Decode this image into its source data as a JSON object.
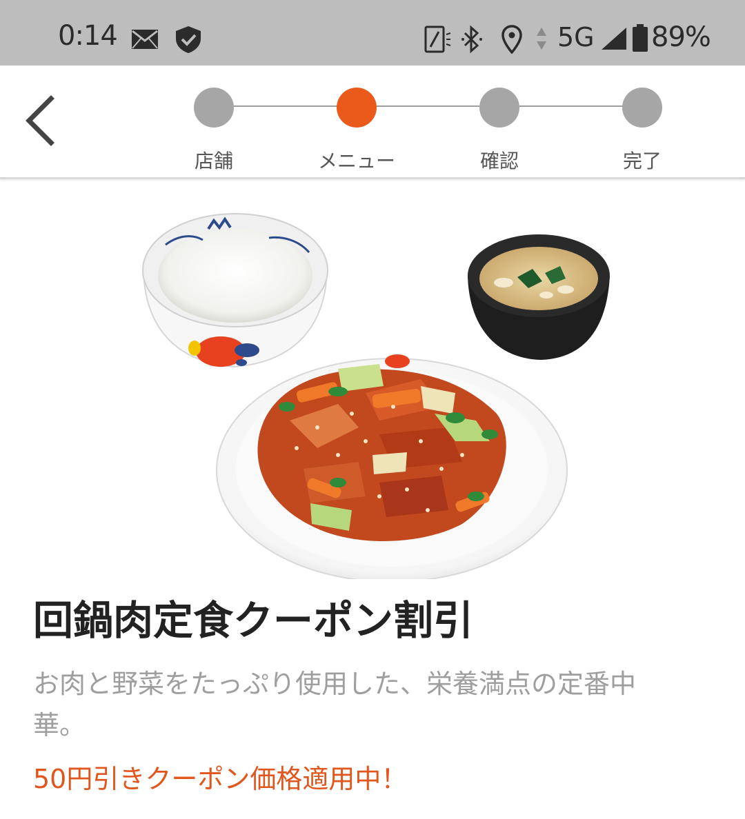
{
  "status_bar": {
    "time": "0:14",
    "network": "5G",
    "battery": "89%",
    "icons": [
      "mail-icon",
      "shield-check-icon",
      "nfc-icon",
      "bluetooth-icon",
      "location-icon",
      "data-arrows-icon",
      "signal-icon",
      "battery-icon"
    ]
  },
  "header": {
    "back_icon": "chevron-left-icon",
    "steps": [
      {
        "label": "店舗",
        "active": false
      },
      {
        "label": "メニュー",
        "active": true
      },
      {
        "label": "確認",
        "active": false
      },
      {
        "label": "完了",
        "active": false
      }
    ]
  },
  "item": {
    "image_alt": "回鍋肉定食",
    "title": "回鍋肉定食クーポン割引",
    "description": "お肉と野菜をたっぷり使用した、栄養満点の定番中華。",
    "coupon_notice": "50円引きクーポン価格適用中！"
  },
  "colors": {
    "accent": "#ea5a1b",
    "step_inactive": "#a6a6a6",
    "status_bar_bg": "#bdbdbd",
    "title_text": "#222222",
    "description_text": "#9e9e9e"
  }
}
